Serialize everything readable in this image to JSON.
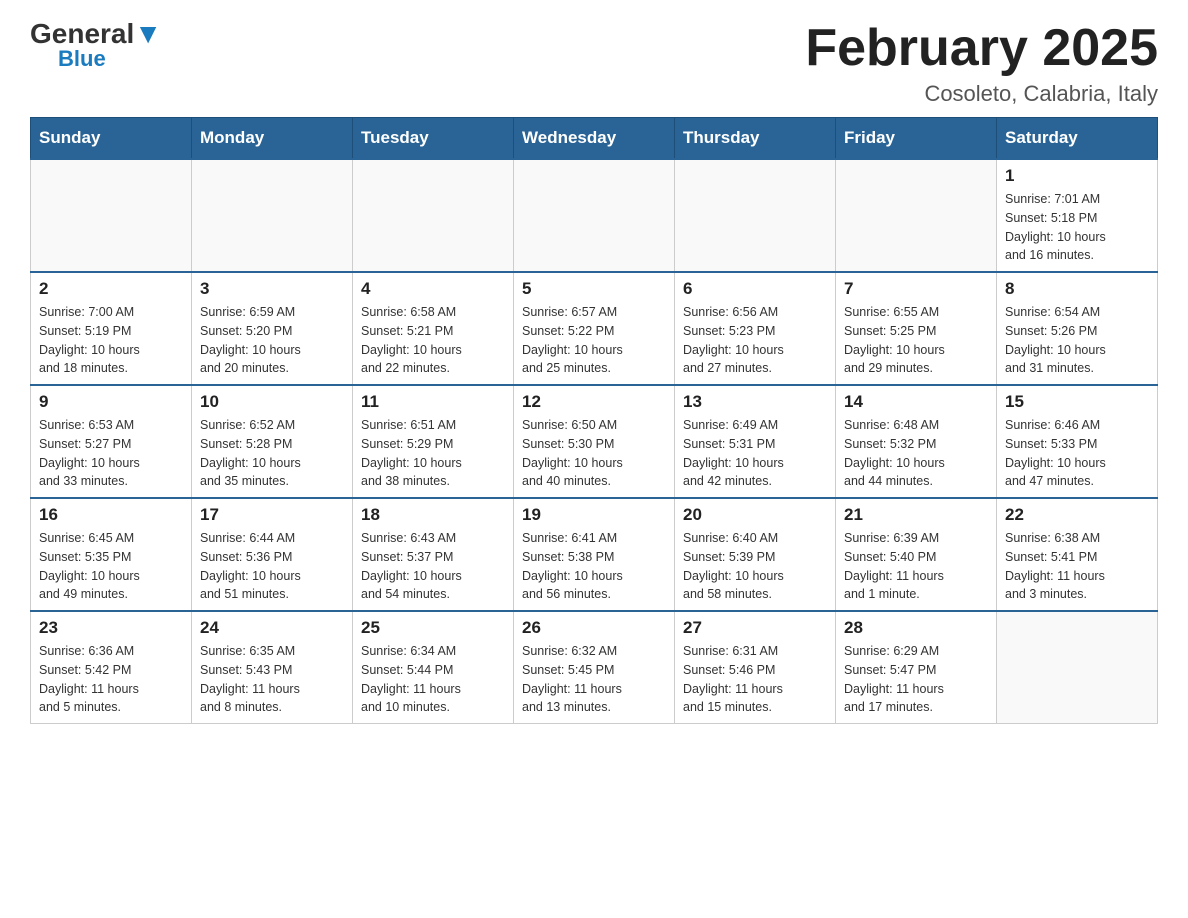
{
  "header": {
    "logo_general": "General",
    "logo_blue": "Blue",
    "month_title": "February 2025",
    "location": "Cosoleto, Calabria, Italy"
  },
  "weekdays": [
    "Sunday",
    "Monday",
    "Tuesday",
    "Wednesday",
    "Thursday",
    "Friday",
    "Saturday"
  ],
  "weeks": [
    [
      {
        "day": "",
        "info": ""
      },
      {
        "day": "",
        "info": ""
      },
      {
        "day": "",
        "info": ""
      },
      {
        "day": "",
        "info": ""
      },
      {
        "day": "",
        "info": ""
      },
      {
        "day": "",
        "info": ""
      },
      {
        "day": "1",
        "info": "Sunrise: 7:01 AM\nSunset: 5:18 PM\nDaylight: 10 hours\nand 16 minutes."
      }
    ],
    [
      {
        "day": "2",
        "info": "Sunrise: 7:00 AM\nSunset: 5:19 PM\nDaylight: 10 hours\nand 18 minutes."
      },
      {
        "day": "3",
        "info": "Sunrise: 6:59 AM\nSunset: 5:20 PM\nDaylight: 10 hours\nand 20 minutes."
      },
      {
        "day": "4",
        "info": "Sunrise: 6:58 AM\nSunset: 5:21 PM\nDaylight: 10 hours\nand 22 minutes."
      },
      {
        "day": "5",
        "info": "Sunrise: 6:57 AM\nSunset: 5:22 PM\nDaylight: 10 hours\nand 25 minutes."
      },
      {
        "day": "6",
        "info": "Sunrise: 6:56 AM\nSunset: 5:23 PM\nDaylight: 10 hours\nand 27 minutes."
      },
      {
        "day": "7",
        "info": "Sunrise: 6:55 AM\nSunset: 5:25 PM\nDaylight: 10 hours\nand 29 minutes."
      },
      {
        "day": "8",
        "info": "Sunrise: 6:54 AM\nSunset: 5:26 PM\nDaylight: 10 hours\nand 31 minutes."
      }
    ],
    [
      {
        "day": "9",
        "info": "Sunrise: 6:53 AM\nSunset: 5:27 PM\nDaylight: 10 hours\nand 33 minutes."
      },
      {
        "day": "10",
        "info": "Sunrise: 6:52 AM\nSunset: 5:28 PM\nDaylight: 10 hours\nand 35 minutes."
      },
      {
        "day": "11",
        "info": "Sunrise: 6:51 AM\nSunset: 5:29 PM\nDaylight: 10 hours\nand 38 minutes."
      },
      {
        "day": "12",
        "info": "Sunrise: 6:50 AM\nSunset: 5:30 PM\nDaylight: 10 hours\nand 40 minutes."
      },
      {
        "day": "13",
        "info": "Sunrise: 6:49 AM\nSunset: 5:31 PM\nDaylight: 10 hours\nand 42 minutes."
      },
      {
        "day": "14",
        "info": "Sunrise: 6:48 AM\nSunset: 5:32 PM\nDaylight: 10 hours\nand 44 minutes."
      },
      {
        "day": "15",
        "info": "Sunrise: 6:46 AM\nSunset: 5:33 PM\nDaylight: 10 hours\nand 47 minutes."
      }
    ],
    [
      {
        "day": "16",
        "info": "Sunrise: 6:45 AM\nSunset: 5:35 PM\nDaylight: 10 hours\nand 49 minutes."
      },
      {
        "day": "17",
        "info": "Sunrise: 6:44 AM\nSunset: 5:36 PM\nDaylight: 10 hours\nand 51 minutes."
      },
      {
        "day": "18",
        "info": "Sunrise: 6:43 AM\nSunset: 5:37 PM\nDaylight: 10 hours\nand 54 minutes."
      },
      {
        "day": "19",
        "info": "Sunrise: 6:41 AM\nSunset: 5:38 PM\nDaylight: 10 hours\nand 56 minutes."
      },
      {
        "day": "20",
        "info": "Sunrise: 6:40 AM\nSunset: 5:39 PM\nDaylight: 10 hours\nand 58 minutes."
      },
      {
        "day": "21",
        "info": "Sunrise: 6:39 AM\nSunset: 5:40 PM\nDaylight: 11 hours\nand 1 minute."
      },
      {
        "day": "22",
        "info": "Sunrise: 6:38 AM\nSunset: 5:41 PM\nDaylight: 11 hours\nand 3 minutes."
      }
    ],
    [
      {
        "day": "23",
        "info": "Sunrise: 6:36 AM\nSunset: 5:42 PM\nDaylight: 11 hours\nand 5 minutes."
      },
      {
        "day": "24",
        "info": "Sunrise: 6:35 AM\nSunset: 5:43 PM\nDaylight: 11 hours\nand 8 minutes."
      },
      {
        "day": "25",
        "info": "Sunrise: 6:34 AM\nSunset: 5:44 PM\nDaylight: 11 hours\nand 10 minutes."
      },
      {
        "day": "26",
        "info": "Sunrise: 6:32 AM\nSunset: 5:45 PM\nDaylight: 11 hours\nand 13 minutes."
      },
      {
        "day": "27",
        "info": "Sunrise: 6:31 AM\nSunset: 5:46 PM\nDaylight: 11 hours\nand 15 minutes."
      },
      {
        "day": "28",
        "info": "Sunrise: 6:29 AM\nSunset: 5:47 PM\nDaylight: 11 hours\nand 17 minutes."
      },
      {
        "day": "",
        "info": ""
      }
    ]
  ]
}
